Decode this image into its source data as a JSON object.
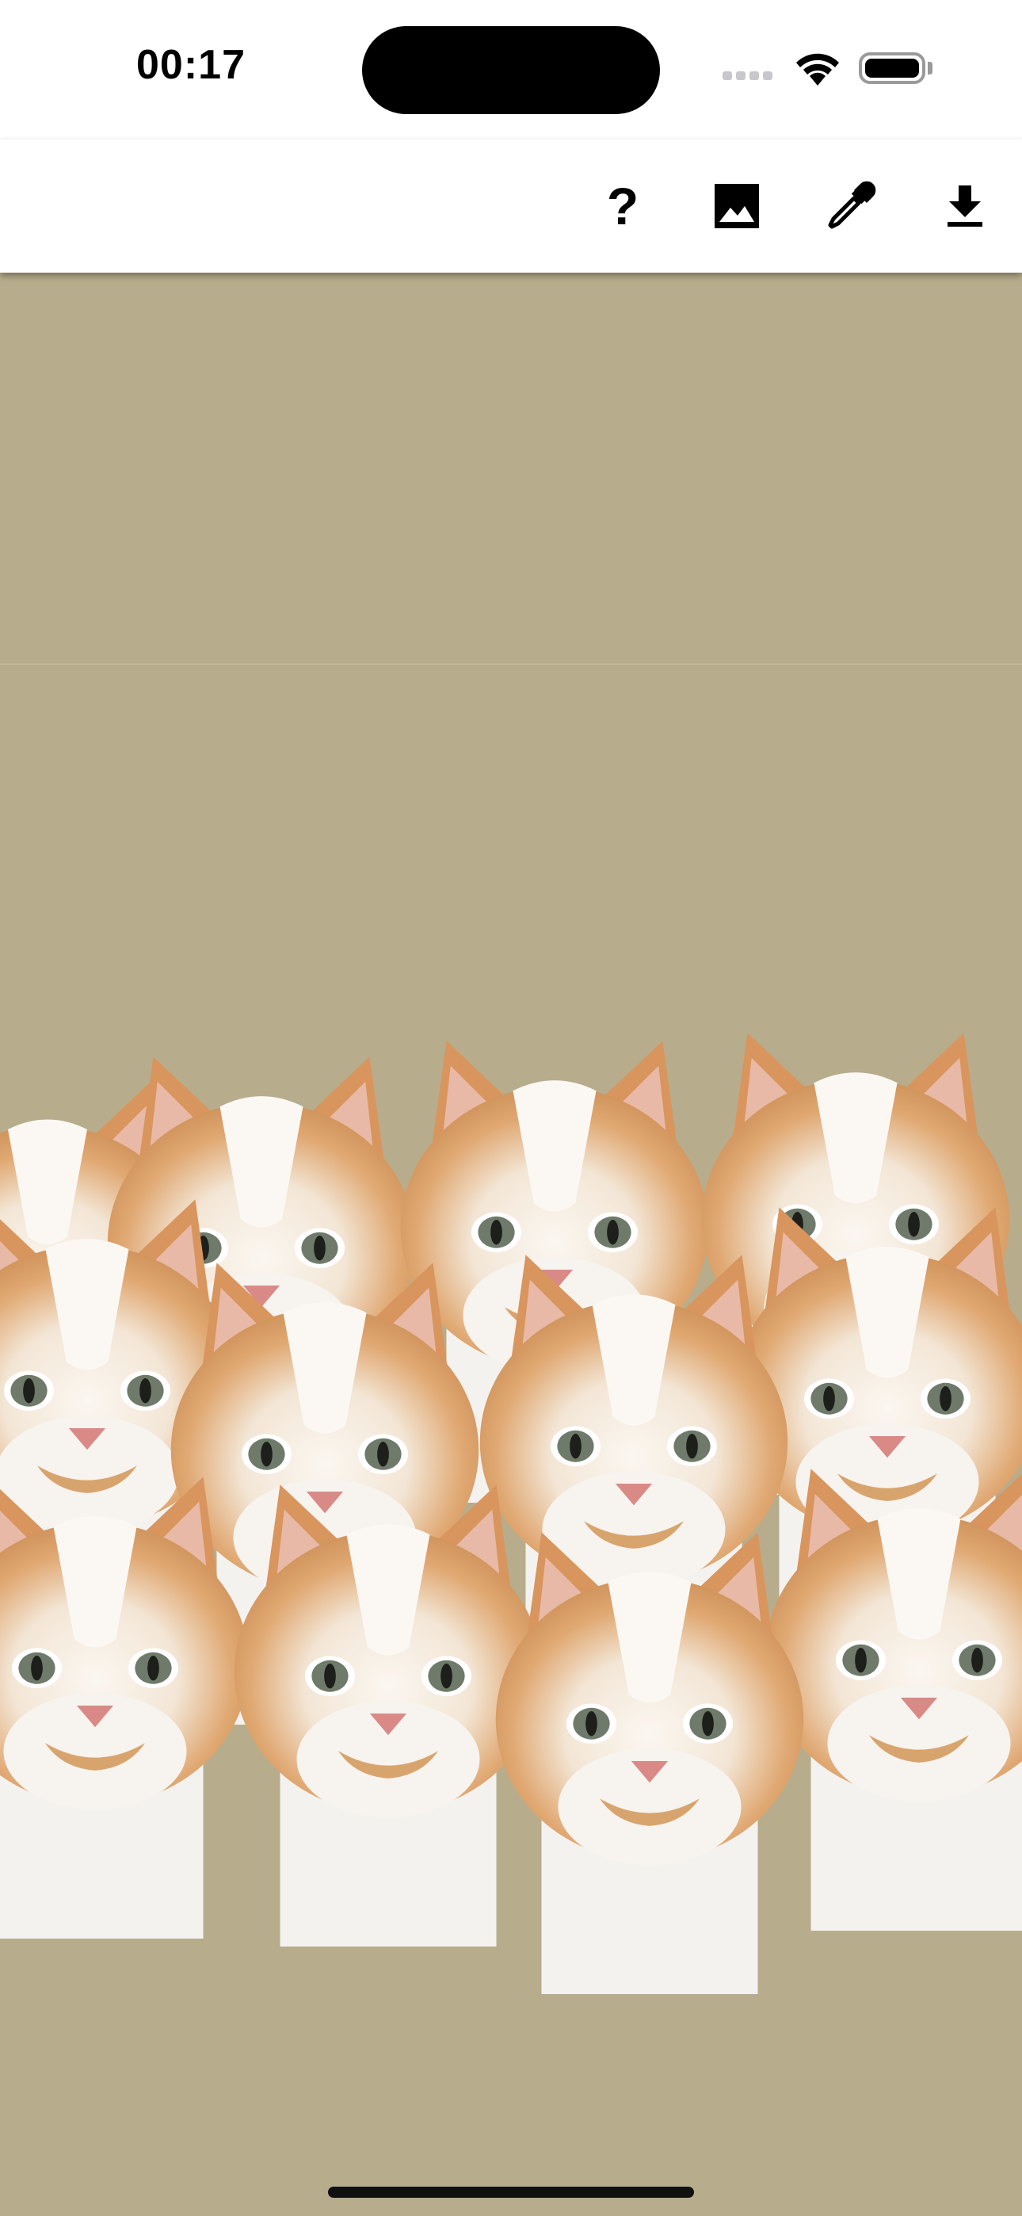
{
  "status_bar": {
    "time": "00:17",
    "signal_icon": "cellular-signal-icon",
    "wifi_icon": "wifi-icon",
    "battery_icon": "battery-icon"
  },
  "toolbar": {
    "help_label": "?",
    "actions": [
      "help-icon",
      "image-icon",
      "color-picker-icon",
      "download-icon"
    ]
  },
  "canvas": {
    "background_color": "#b7ad8c",
    "sticker": "cat-face-sticker"
  }
}
